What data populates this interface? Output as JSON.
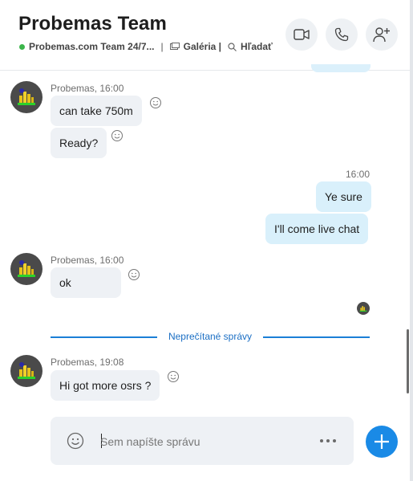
{
  "header": {
    "title": "Probemas Team",
    "status": "Probemas.com Team 24/7...",
    "separator": "|",
    "gallery_label": "Galéria |",
    "search_label": "Hľadať",
    "buttons": [
      "video-call",
      "voice-call",
      "add-person"
    ]
  },
  "messages": [
    {
      "group": 1,
      "sender_meta": "Probemas, 16:00",
      "bubbles": [
        "can take 750m",
        "Ready?"
      ]
    },
    {
      "group": 2,
      "time": "16:00",
      "outgoing": [
        "Ye sure",
        "I'll come live chat"
      ]
    },
    {
      "group": 3,
      "sender_meta": "Probemas, 16:00",
      "bubbles": [
        "ok"
      ]
    },
    {
      "group": 4,
      "sender_meta": "Probemas, 19:08",
      "bubbles": [
        "Hi got more osrs ?"
      ]
    }
  ],
  "unread_label": "Neprečítané správy",
  "composer": {
    "placeholder": "Sem napíšte správu"
  },
  "colors": {
    "accent": "#1a8ae6",
    "online": "#3bb54a",
    "incoming_bubble": "#eef1f5",
    "outgoing_bubble": "#d9f0fb"
  }
}
